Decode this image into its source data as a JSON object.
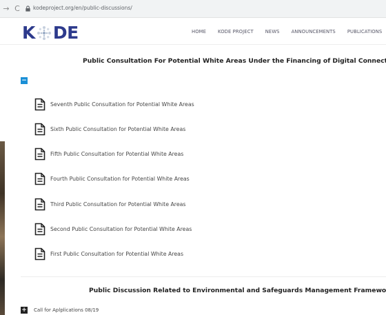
{
  "browser": {
    "url": "kodeproject.org/en/public-discussions/",
    "forward_icon": "arrow-right-icon",
    "reload_icon": "reload-icon",
    "lock_icon": "lock-icon"
  },
  "header": {
    "logo_left": "K",
    "logo_right": "DE",
    "logo_symbol": "star-burst-logo",
    "brand_color": "#2d3a8c",
    "nav": [
      "HOME",
      "KODE PROJECT",
      "NEWS",
      "ANNOUNCEMENTS",
      "PUBLICATIONS"
    ]
  },
  "sections": [
    {
      "title": "Public Consultation For Potential White Areas Under the Financing of Digital Connectivity",
      "toggle": "−",
      "toggle_color": "#1a8fd6",
      "expanded": true,
      "items": [
        "Seventh Public Consultation for Potential White Areas",
        "Sixth Public Consultation for Potential White Areas",
        "Fifth Public Consultation for Potential White Areas",
        "Fourth Public Consultation for Potential White Areas",
        "Third Public Consultation for Potential White Areas",
        "Second Public Consultation for Potential White Areas",
        "First Public Consultation for Potential White Areas"
      ]
    },
    {
      "title": "Public Discussion Related to Environmental and Safeguards Management Framework",
      "toggle": "+",
      "expanded": false,
      "items": [
        "Call for Aplplications 08/19"
      ]
    }
  ]
}
